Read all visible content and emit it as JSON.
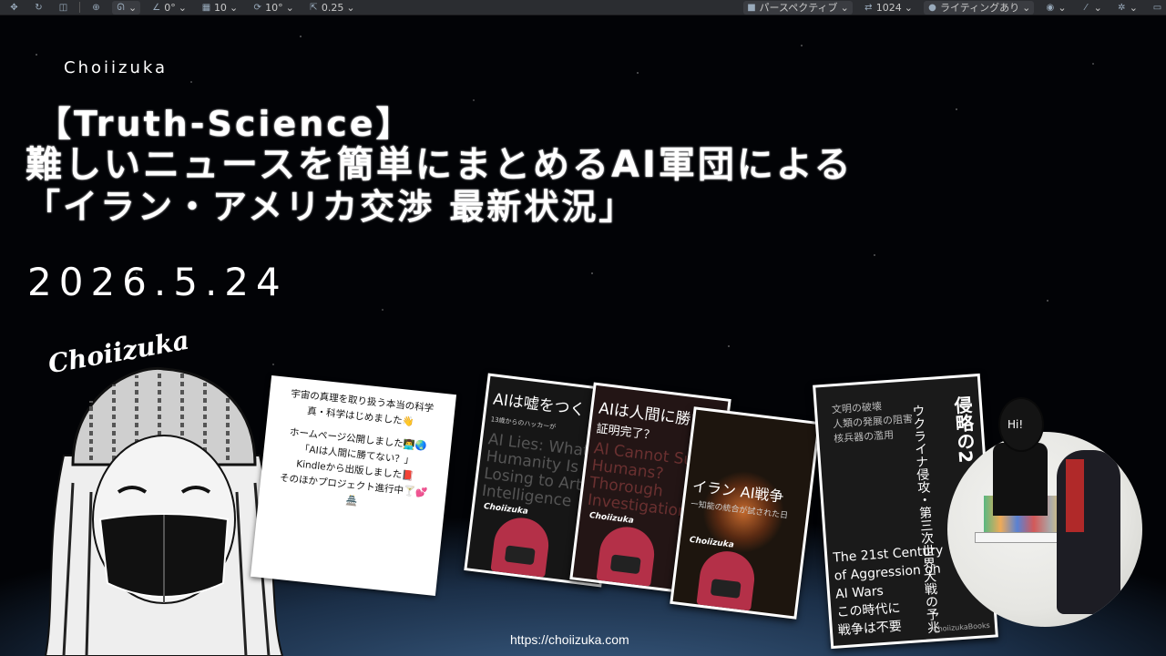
{
  "toolbar": {
    "items": [
      {
        "icon": "move-icon",
        "label": ""
      },
      {
        "icon": "rotate-icon",
        "label": ""
      },
      {
        "icon": "scale-icon",
        "label": ""
      },
      {
        "icon": "globe-icon",
        "label": ""
      },
      {
        "icon": "snap-icon",
        "label": ""
      },
      {
        "icon": "angle-icon",
        "label": "0°"
      },
      {
        "icon": "grid-icon",
        "label": "10"
      },
      {
        "icon": "rotate-snap-icon",
        "label": "10°"
      },
      {
        "icon": "scale-snap-icon",
        "label": "0.25"
      }
    ],
    "perspective": "パースペクティブ",
    "resolution": "1024",
    "lighting": "ライティングあり"
  },
  "heading": {
    "brand": "Choiizuka",
    "line1": "【Truth-Science】",
    "line2": "難しいニュースを簡単にまとめるAI軍団による",
    "line3": "「イラン・アメリカ交渉 最新状況」",
    "date": "2026.5.24"
  },
  "avatar": {
    "name": "Choiizuka"
  },
  "note": {
    "lines": [
      "宇宙の真理を取り扱う本当の科学",
      "真・科学はじめました👋",
      "",
      "ホームページ公開しました👨‍💻🌏",
      "「AIは人間に勝てない？」",
      "Kindleから出版しました📕",
      "そのほかプロジェクト進行中🍸💕",
      "🏯"
    ]
  },
  "books": [
    {
      "title": "AIは嘘をつく",
      "sub": "13歳からのハッカーが",
      "en": "AI Lies: What Humanity Is Losing to Artificial Intelligence",
      "brand": "Choiizuka"
    },
    {
      "title": "AIは人間に勝て",
      "sub": "証明完了？",
      "en": "AI Cannot Surpass Humans? Thorough Investigation",
      "brand": "Choiizuka"
    },
    {
      "title": "イラン AI戦争",
      "sub": "ー知能の統合が試された日",
      "en": "",
      "brand": "Choiizuka"
    },
    {
      "vertical_title": "侵略の2",
      "vertical_sub": "ウクライナ侵攻・第三次世界大戦の予兆",
      "small": "文明の破壊\n人類の発展の阻害\n核兵器の濫用",
      "mid": "The 21st Century of Aggression on AI Wars\nこの時代に\n戦争は不要",
      "brand": "ChoiizukaBooks"
    }
  ],
  "photo": {
    "bubble": "Hi!"
  },
  "footer": {
    "url": "https://choiizuka.com"
  }
}
